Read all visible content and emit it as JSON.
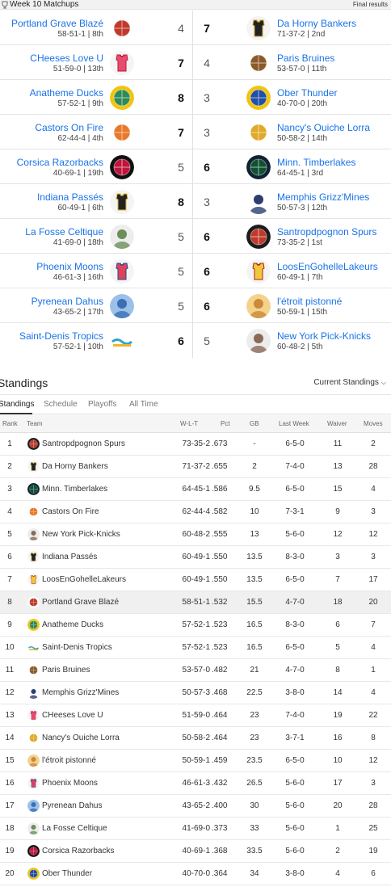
{
  "header": {
    "week_title": "Week 10 Matchups",
    "final_label": "Final results"
  },
  "teams": {
    "T1": {
      "name": "Santropdpognon Spurs",
      "short": "Santropdpognon Spurs",
      "color": "#c0392b",
      "style": "ball",
      "bg": "#1c1c1c"
    },
    "T2": {
      "name": "Da Horny Bankers",
      "color": "#222222",
      "style": "jersey",
      "trim": "#c9a227"
    },
    "T3": {
      "name": "Minn. Timberlakes",
      "color": "#0f5132",
      "style": "ball",
      "bg": "#123"
    },
    "T4": {
      "name": "Castors On Fire",
      "color": "#e8782a",
      "style": "ball",
      "bg": "#ffffff"
    },
    "T5": {
      "name": "New York Pick-Knicks",
      "color": "#8a6a55",
      "style": "face",
      "bg": "#ececec"
    },
    "T6": {
      "name": "Indiana Passés",
      "color": "#222222",
      "style": "jersey",
      "trim": "#e0b830"
    },
    "T7": {
      "name": "LoosEnGohelleLakeurs",
      "color": "#f0c93a",
      "style": "jersey",
      "trim": "#b11c1c"
    },
    "T8": {
      "name": "Portland Grave Blazé",
      "color": "#c0392b",
      "style": "ball",
      "bg": "#ffffff"
    },
    "T9": {
      "name": "Anatheme Ducks",
      "color": "#2e8b57",
      "style": "ball",
      "bg": "#f1c40f"
    },
    "T10": {
      "name": "Saint-Denis Tropics",
      "color": "#2fa4c8",
      "style": "text",
      "bg": "#ffffff"
    },
    "T11": {
      "name": "Paris Bruines",
      "color": "#8b5a2b",
      "style": "ball",
      "bg": "#ffffff"
    },
    "T12": {
      "name": "Memphis Grizz'Mines",
      "color": "#2c3e70",
      "style": "face",
      "bg": "#ffffff"
    },
    "T13": {
      "name": "CHeeses Love U",
      "color": "#e74c6f",
      "style": "jersey",
      "trim": "#c0143c"
    },
    "T14": {
      "name": "Nancy's Ouiche Lorra",
      "color": "#e0a928",
      "style": "ball",
      "bg": "#ffffff"
    },
    "T15": {
      "name": "l'étroit pistonné",
      "color": "#c98a3a",
      "style": "face",
      "bg": "#f5d28a"
    },
    "T16": {
      "name": "Phoenix Moons",
      "color": "#e0415a",
      "style": "jersey",
      "trim": "#1a4a8a"
    },
    "T17": {
      "name": "Pyrenean Dahus",
      "color": "#3b6fb6",
      "style": "face",
      "bg": "#9bc1e8"
    },
    "T18": {
      "name": "La Fosse Celtique",
      "color": "#6b8e5a",
      "style": "face",
      "bg": "#ededed"
    },
    "T19": {
      "name": "Corsica Razorbacks",
      "color": "#c0143c",
      "style": "ball",
      "bg": "#111111"
    },
    "T20": {
      "name": "Ober Thunder",
      "color": "#1f4fa8",
      "style": "ball",
      "bg": "#f1c40f"
    }
  },
  "matchups": [
    {
      "left": {
        "team": "T8",
        "name": "Portland Grave Blazé",
        "record": "58-51-1 | 8th",
        "score": "4"
      },
      "right": {
        "team": "T2",
        "name": "Da Horny Bankers",
        "record": "71-37-2 | 2nd",
        "score": "7"
      },
      "winner": "right"
    },
    {
      "left": {
        "team": "T13",
        "name": "CHeeses Love U",
        "record": "51-59-0 | 13th",
        "score": "7"
      },
      "right": {
        "team": "T11",
        "name": "Paris Bruines",
        "record": "53-57-0 | 11th",
        "score": "4"
      },
      "winner": "left"
    },
    {
      "left": {
        "team": "T9",
        "name": "Anatheme Ducks",
        "record": "57-52-1 | 9th",
        "score": "8"
      },
      "right": {
        "team": "T20",
        "name": "Ober Thunder",
        "record": "40-70-0 | 20th",
        "score": "3"
      },
      "winner": "left"
    },
    {
      "left": {
        "team": "T4",
        "name": "Castors On Fire",
        "record": "62-44-4 | 4th",
        "score": "7"
      },
      "right": {
        "team": "T14",
        "name": "Nancy's Ouiche Lorra",
        "record": "50-58-2 | 14th",
        "score": "3"
      },
      "winner": "left"
    },
    {
      "left": {
        "team": "T19",
        "name": "Corsica Razorbacks",
        "record": "40-69-1 | 19th",
        "score": "5"
      },
      "right": {
        "team": "T3",
        "name": "Minn. Timberlakes",
        "record": "64-45-1 | 3rd",
        "score": "6"
      },
      "winner": "right"
    },
    {
      "left": {
        "team": "T6",
        "name": "Indiana Passés",
        "record": "60-49-1 | 6th",
        "score": "8"
      },
      "right": {
        "team": "T12",
        "name": "Memphis Grizz'Mines",
        "record": "50-57-3 | 12th",
        "score": "3"
      },
      "winner": "left"
    },
    {
      "left": {
        "team": "T18",
        "name": "La Fosse Celtique",
        "record": "41-69-0 | 18th",
        "score": "5"
      },
      "right": {
        "team": "T1",
        "name": "Santropdpognon Spurs",
        "record": "73-35-2 | 1st",
        "score": "6"
      },
      "winner": "right"
    },
    {
      "left": {
        "team": "T16",
        "name": "Phoenix Moons",
        "record": "46-61-3 | 16th",
        "score": "5"
      },
      "right": {
        "team": "T7",
        "name": "LoosEnGohelleLakeurs",
        "record": "60-49-1 | 7th",
        "score": "6"
      },
      "winner": "right"
    },
    {
      "left": {
        "team": "T17",
        "name": "Pyrenean Dahus",
        "record": "43-65-2 | 17th",
        "score": "5"
      },
      "right": {
        "team": "T15",
        "name": "l'étroit pistonné",
        "record": "50-59-1 | 15th",
        "score": "6"
      },
      "winner": "right"
    },
    {
      "left": {
        "team": "T10",
        "name": "Saint-Denis Tropics",
        "record": "57-52-1 | 10th",
        "score": "6"
      },
      "right": {
        "team": "T5",
        "name": "New York Pick-Knicks",
        "record": "60-48-2 | 5th",
        "score": "5"
      },
      "winner": "left"
    }
  ],
  "standings": {
    "title": "Standings",
    "selector": "Current Standings",
    "tabs": [
      "Standings",
      "Schedule",
      "Playoffs",
      "All Time"
    ],
    "columns": {
      "rank": "Rank",
      "team": "Team",
      "wlt": "W-L-T",
      "pct": "Pct",
      "gb": "GB",
      "last_week": "Last Week",
      "waiver": "Waiver",
      "moves": "Moves"
    },
    "rows": [
      {
        "rank": "1",
        "team": "T1",
        "name": "Santropdpognon Spurs",
        "wlt": "73-35-2",
        "pct": ".673",
        "gb": "-",
        "last_week": "6-5-0",
        "waiver": "11",
        "moves": "2"
      },
      {
        "rank": "2",
        "team": "T2",
        "name": "Da Horny Bankers",
        "wlt": "71-37-2",
        "pct": ".655",
        "gb": "2",
        "last_week": "7-4-0",
        "waiver": "13",
        "moves": "28"
      },
      {
        "rank": "3",
        "team": "T3",
        "name": "Minn. Timberlakes",
        "wlt": "64-45-1",
        "pct": ".586",
        "gb": "9.5",
        "last_week": "6-5-0",
        "waiver": "15",
        "moves": "4"
      },
      {
        "rank": "4",
        "team": "T4",
        "name": "Castors On Fire",
        "wlt": "62-44-4",
        "pct": ".582",
        "gb": "10",
        "last_week": "7-3-1",
        "waiver": "9",
        "moves": "3"
      },
      {
        "rank": "5",
        "team": "T5",
        "name": "New York Pick-Knicks",
        "wlt": "60-48-2",
        "pct": ".555",
        "gb": "13",
        "last_week": "5-6-0",
        "waiver": "12",
        "moves": "12"
      },
      {
        "rank": "6",
        "team": "T6",
        "name": "Indiana Passés",
        "wlt": "60-49-1",
        "pct": ".550",
        "gb": "13.5",
        "last_week": "8-3-0",
        "waiver": "3",
        "moves": "3"
      },
      {
        "rank": "7",
        "team": "T7",
        "name": "LoosEnGohelleLakeurs",
        "wlt": "60-49-1",
        "pct": ".550",
        "gb": "13.5",
        "last_week": "6-5-0",
        "waiver": "7",
        "moves": "17"
      },
      {
        "rank": "8",
        "team": "T8",
        "name": "Portland Grave Blazé",
        "wlt": "58-51-1",
        "pct": ".532",
        "gb": "15.5",
        "last_week": "4-7-0",
        "waiver": "18",
        "moves": "20",
        "highlight": true
      },
      {
        "rank": "9",
        "team": "T9",
        "name": "Anatheme Ducks",
        "wlt": "57-52-1",
        "pct": ".523",
        "gb": "16.5",
        "last_week": "8-3-0",
        "waiver": "6",
        "moves": "7"
      },
      {
        "rank": "10",
        "team": "T10",
        "name": "Saint-Denis Tropics",
        "wlt": "57-52-1",
        "pct": ".523",
        "gb": "16.5",
        "last_week": "6-5-0",
        "waiver": "5",
        "moves": "4"
      },
      {
        "rank": "11",
        "team": "T11",
        "name": "Paris Bruines",
        "wlt": "53-57-0",
        "pct": ".482",
        "gb": "21",
        "last_week": "4-7-0",
        "waiver": "8",
        "moves": "1"
      },
      {
        "rank": "12",
        "team": "T12",
        "name": "Memphis Grizz'Mines",
        "wlt": "50-57-3",
        "pct": ".468",
        "gb": "22.5",
        "last_week": "3-8-0",
        "waiver": "14",
        "moves": "4"
      },
      {
        "rank": "13",
        "team": "T13",
        "name": "CHeeses Love U",
        "wlt": "51-59-0",
        "pct": ".464",
        "gb": "23",
        "last_week": "7-4-0",
        "waiver": "19",
        "moves": "22"
      },
      {
        "rank": "14",
        "team": "T14",
        "name": "Nancy's Ouiche Lorra",
        "wlt": "50-58-2",
        "pct": ".464",
        "gb": "23",
        "last_week": "3-7-1",
        "waiver": "16",
        "moves": "8"
      },
      {
        "rank": "15",
        "team": "T15",
        "name": "l'étroit pistonné",
        "wlt": "50-59-1",
        "pct": ".459",
        "gb": "23.5",
        "last_week": "6-5-0",
        "waiver": "10",
        "moves": "12"
      },
      {
        "rank": "16",
        "team": "T16",
        "name": "Phoenix Moons",
        "wlt": "46-61-3",
        "pct": ".432",
        "gb": "26.5",
        "last_week": "5-6-0",
        "waiver": "17",
        "moves": "3"
      },
      {
        "rank": "17",
        "team": "T17",
        "name": "Pyrenean Dahus",
        "wlt": "43-65-2",
        "pct": ".400",
        "gb": "30",
        "last_week": "5-6-0",
        "waiver": "20",
        "moves": "28"
      },
      {
        "rank": "18",
        "team": "T18",
        "name": "La Fosse Celtique",
        "wlt": "41-69-0",
        "pct": ".373",
        "gb": "33",
        "last_week": "5-6-0",
        "waiver": "1",
        "moves": "25"
      },
      {
        "rank": "19",
        "team": "T19",
        "name": "Corsica Razorbacks",
        "wlt": "40-69-1",
        "pct": ".368",
        "gb": "33.5",
        "last_week": "5-6-0",
        "waiver": "2",
        "moves": "19"
      },
      {
        "rank": "20",
        "team": "T20",
        "name": "Ober Thunder",
        "wlt": "40-70-0",
        "pct": ".364",
        "gb": "34",
        "last_week": "3-8-0",
        "waiver": "4",
        "moves": "6"
      }
    ]
  }
}
